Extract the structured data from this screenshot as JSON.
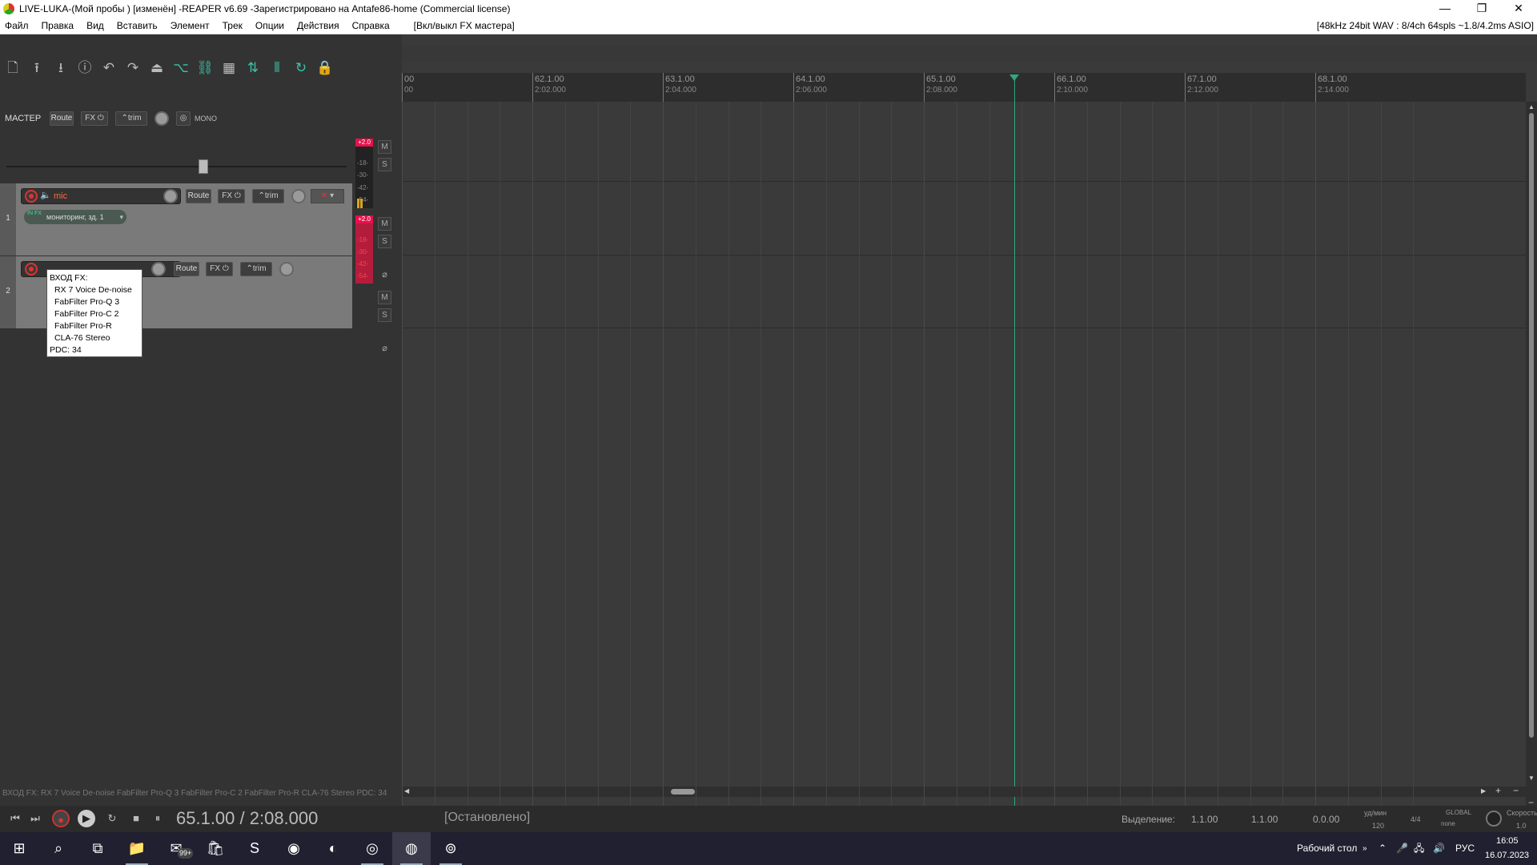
{
  "window": {
    "title": "LIVE-LUKA-(Мой пробы ) [изменён] -REAPER v6.69 -Зарегистрировано на Antafe86-home (Commercial license)",
    "controls": [
      "—",
      "❐",
      "✕"
    ]
  },
  "menubar": {
    "items": [
      "Файл",
      "Правка",
      "Вид",
      "Вставить",
      "Элемент",
      "Трек",
      "Опции",
      "Действия",
      "Справка"
    ],
    "fx_master_toggle": "[Вкл/выкл FX мастера]",
    "audio_status": "[48kHz 24bit WAV : 8/4ch 64spls ~1.8/4.2ms ASIO]"
  },
  "toolbar": {
    "icons": [
      "new-project-icon",
      "open-project-icon",
      "save-project-icon",
      "project-info-icon",
      "undo-icon",
      "redo-icon",
      "metronome-icon",
      "ripple-edit-icon",
      "item-grouping-icon",
      "grid-icon",
      "auto-crossfade-icon",
      "snap-icon",
      "loop-icon",
      "lock-icon"
    ],
    "glyphs": [
      "🗋",
      "⭱",
      "⭳",
      "ⓘ",
      "↶",
      "↷",
      "⏏",
      "⌥",
      "⛓",
      "▦",
      "⇅",
      "⦀",
      "↻",
      "🔒"
    ]
  },
  "master": {
    "label": "МАСТЕР",
    "route": "Route",
    "fx": "FX",
    "trim": "trim",
    "mono": "MONO",
    "peak": "+2.0",
    "meter_scale": [
      "-18-",
      "-30-",
      "-42-",
      "-54-"
    ],
    "mute": "M",
    "solo": "S",
    "volume_fraction": 0.58
  },
  "tracks": [
    {
      "number": "1",
      "name": "mic",
      "route": "Route",
      "fx": "FX",
      "trim": "trim",
      "input_fx_badge": "IN FX",
      "input_fx_chain": "мониторинг, зд. 1",
      "peak": "+2.0",
      "meter_scale": [
        "-18-",
        "-30-",
        "-42-",
        "-54-"
      ],
      "mute": "M",
      "solo": "S",
      "phase": "⌀",
      "fx_bypass_glyph": "✕"
    },
    {
      "number": "2",
      "name": "",
      "route": "Route",
      "fx": "FX",
      "trim": "trim",
      "mute": "M",
      "solo": "S",
      "phase": "⌀"
    }
  ],
  "tooltip": {
    "header": "ВХОД FX:",
    "items": [
      "RX 7 Voice De-noise",
      "FabFilter Pro-Q 3",
      "FabFilter Pro-C 2",
      "FabFilter Pro-R",
      "CLA-76 Stereo"
    ],
    "pdc": "PDC: 34"
  },
  "ruler": {
    "marks": [
      {
        "bar": "00",
        "time": "00"
      },
      {
        "bar": "62.1.00",
        "time": "2:02.000"
      },
      {
        "bar": "63.1.00",
        "time": "2:04.000"
      },
      {
        "bar": "64.1.00",
        "time": "2:06.000"
      },
      {
        "bar": "65.1.00",
        "time": "2:08.000"
      },
      {
        "bar": "66.1.00",
        "time": "2:10.000"
      },
      {
        "bar": "67.1.00",
        "time": "2:12.000"
      },
      {
        "bar": "68.1.00",
        "time": "2:14.000"
      }
    ],
    "cursor_bar": "65.1.00"
  },
  "status_line": "ВХОД FX:  RX 7 Voice De-noise   FabFilter Pro-Q 3   FabFilter Pro-C 2   FabFilter Pro-R   CLA-76 Stereo PDC: 34",
  "transport": {
    "position": "65.1.00 / 2:08.000",
    "state": "[Остановлено]",
    "selection_label": "Выделение:",
    "selection_start": "1.1.00",
    "selection_end": "1.1.00",
    "selection_length": "0.0.00",
    "bpm_label": "уд/мин",
    "bpm": "120",
    "time_signature": "4/4",
    "global_label": "GLOBAL",
    "global_sub": "none",
    "rate_label": "Скорость",
    "rate": "1.0",
    "buttons": [
      "⏮",
      "⏭",
      "●",
      "▶",
      "↻",
      "■",
      "⏸"
    ]
  },
  "taskbar": {
    "apps": [
      {
        "name": "windows-start-icon",
        "glyph": "⊞"
      },
      {
        "name": "search-icon",
        "glyph": "⌕"
      },
      {
        "name": "task-view-icon",
        "glyph": "⧉"
      },
      {
        "name": "file-explorer-icon",
        "glyph": "📁"
      },
      {
        "name": "mail-icon",
        "glyph": "✉",
        "badge": "99+"
      },
      {
        "name": "store-icon",
        "glyph": "🛍"
      },
      {
        "name": "skype-icon",
        "glyph": "S"
      },
      {
        "name": "discord-icon",
        "glyph": "◉"
      },
      {
        "name": "edge-icon",
        "glyph": "◐"
      },
      {
        "name": "chrome-icon",
        "glyph": "◎"
      },
      {
        "name": "reaper-icon",
        "glyph": "◍"
      },
      {
        "name": "obs-icon",
        "glyph": "⊚"
      }
    ],
    "desktop_label": "Рабочий стол",
    "language": "РУС",
    "time": "16:05",
    "date": "16.07.2023"
  },
  "colors": {
    "accent": "#2ea77f",
    "peak": "#e8104a",
    "record": "#dd3333",
    "track_name": "#ff6a3d"
  }
}
